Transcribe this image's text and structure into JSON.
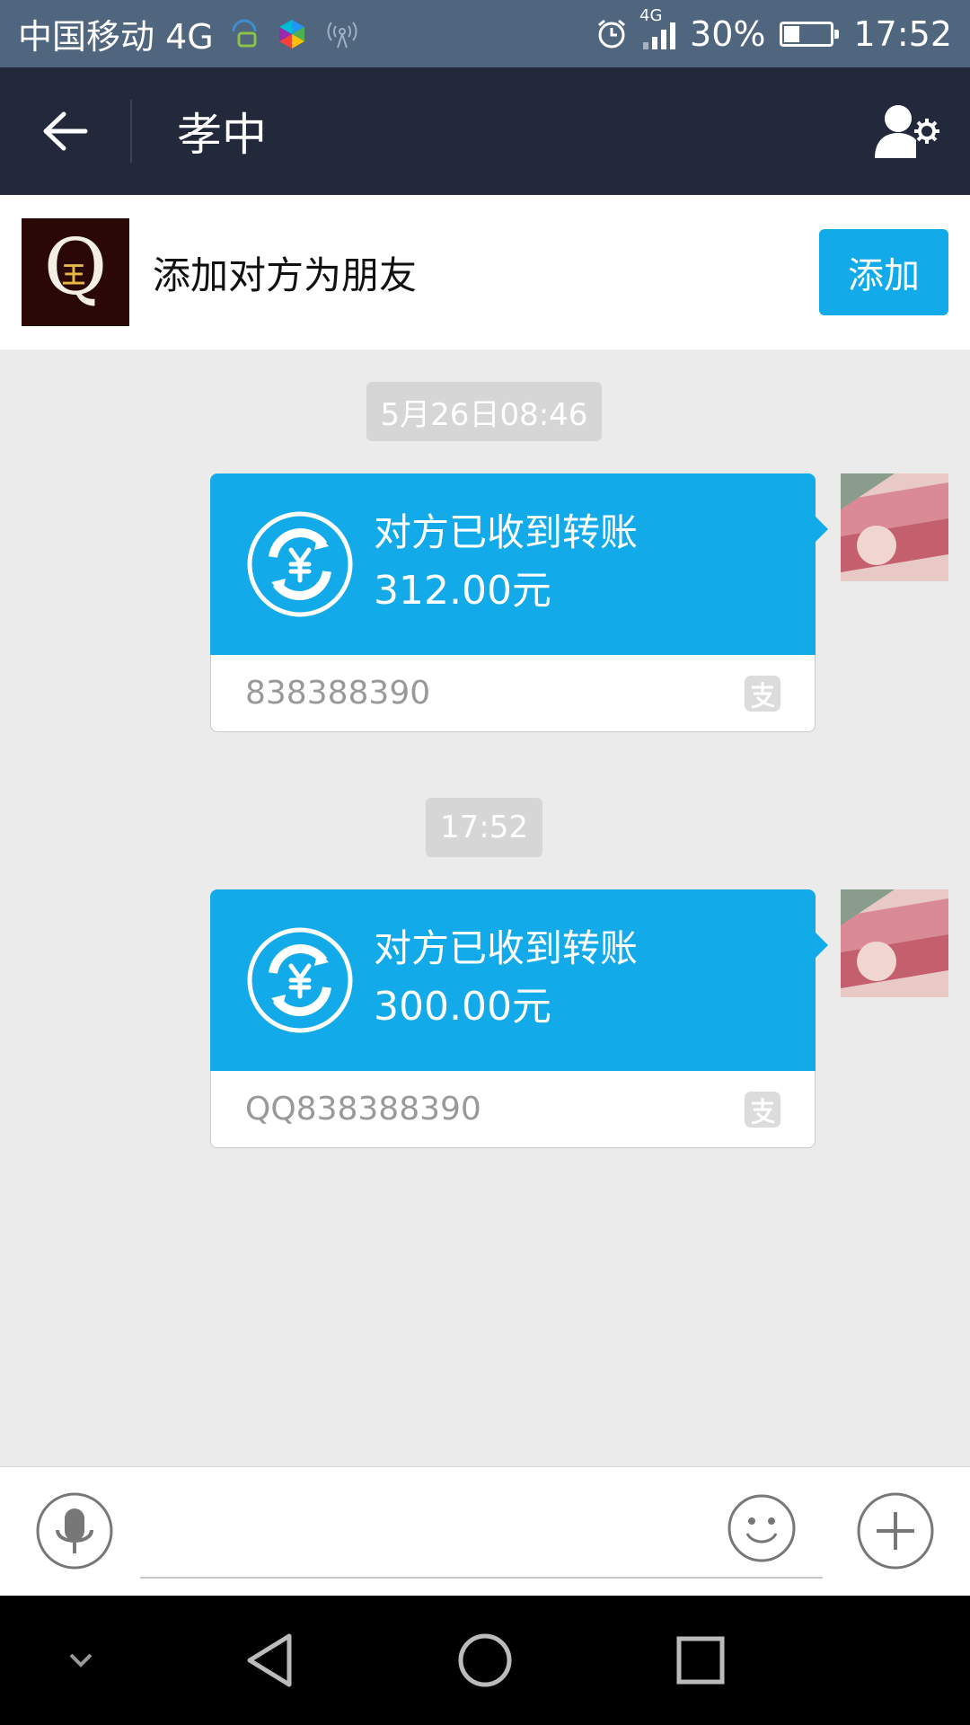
{
  "status_bar": {
    "carrier": "中国移动 4G",
    "network_badge": "4G",
    "battery": "30%",
    "battery_level": 0.3,
    "time": "17:52",
    "icons": [
      "chat-notification-icon",
      "app-icon",
      "hotspot-icon",
      "alarm-icon",
      "signal-icon",
      "battery-icon"
    ]
  },
  "header": {
    "title": "孝中",
    "back_icon": "back-arrow-icon",
    "settings_icon": "profile-settings-icon"
  },
  "add_friend": {
    "text": "添加对方为朋友",
    "button_label": "添加",
    "avatar_letter": "Q",
    "avatar_char": "王"
  },
  "messages": [
    {
      "timestamp": "5月26日08:46",
      "title": "对方已收到转账",
      "amount": "312.00元",
      "note": "838388390"
    },
    {
      "timestamp": "17:52",
      "title": "对方已收到转账",
      "amount": "300.00元",
      "note": "QQ838388390"
    }
  ],
  "input": {
    "placeholder": "",
    "icons": [
      "microphone-icon",
      "emoji-icon",
      "plus-icon"
    ]
  },
  "system_nav": {
    "icons": [
      "collapse-icon",
      "back-triangle-icon",
      "home-circle-icon",
      "recents-square-icon"
    ]
  },
  "colors": {
    "accent": "#12aae8",
    "nav_bg": "#22293a",
    "status_bg": "#50657e",
    "chat_bg": "#ebebeb"
  }
}
